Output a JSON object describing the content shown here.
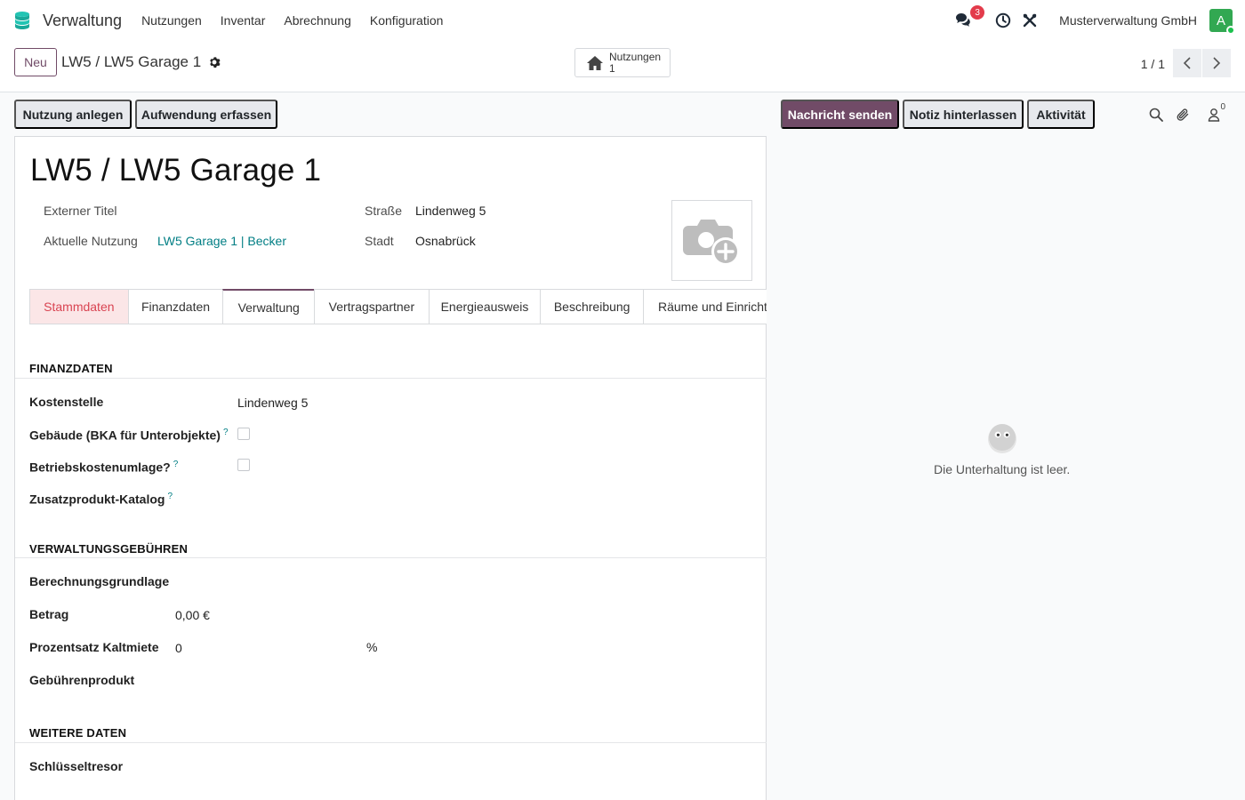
{
  "navbar": {
    "app_name": "Verwaltung",
    "menu": [
      "Nutzungen",
      "Inventar",
      "Abrechnung",
      "Konfiguration"
    ],
    "messages_count": "3",
    "company": "Musterverwaltung GmbH",
    "avatar_letter": "A"
  },
  "control": {
    "new_label": "Neu",
    "breadcrumb": "LW5 / LW5 Garage 1",
    "smart_button": {
      "label": "Nutzungen",
      "count": "1"
    },
    "pager": "1 / 1"
  },
  "actions": {
    "create_usage": "Nutzung anlegen",
    "record_expense": "Aufwendung erfassen"
  },
  "record": {
    "title": "LW5 / LW5 Garage 1",
    "external_title_label": "Externer Titel",
    "external_title_value": "",
    "current_usage_label": "Aktuelle Nutzung",
    "current_usage_value": "LW5 Garage 1 | Becker",
    "street_label": "Straße",
    "street_value": "Lindenweg 5",
    "city_label": "Stadt",
    "city_value": "Osnabrück"
  },
  "tabs": [
    "Stammdaten",
    "Finanzdaten",
    "Verwaltung",
    "Vertragspartner",
    "Energieausweis",
    "Beschreibung",
    "Räume und Einricht"
  ],
  "sections": {
    "finanzdaten": {
      "title": "FINANZDATEN",
      "cost_center_label": "Kostenstelle",
      "cost_center_value": "Lindenweg 5",
      "building_label": "Gebäude (BKA für Unterobjekte)",
      "building_checked": false,
      "operating_cost_label": "Betriebskostenumlage?",
      "operating_cost_checked": false,
      "catalog_label": "Zusatzprodukt-Katalog",
      "help_mark": "?"
    },
    "gebuehren": {
      "title": "VERWALTUNGSGEBÜHREN",
      "basis_label": "Berechnungsgrundlage",
      "amount_label": "Betrag",
      "amount_value": "0,00 €",
      "percent_label": "Prozentsatz Kaltmiete",
      "percent_value": "0",
      "percent_unit": "%",
      "fee_product_label": "Gebührenprodukt"
    },
    "weitere": {
      "title": "WEITERE DATEN",
      "key_safe_label": "Schlüsseltresor"
    }
  },
  "chatter": {
    "send_message": "Nachricht senden",
    "log_note": "Notiz hinterlassen",
    "activity": "Aktivität",
    "followers_count": "0",
    "empty_text": "Die Unterhaltung ist leer."
  }
}
